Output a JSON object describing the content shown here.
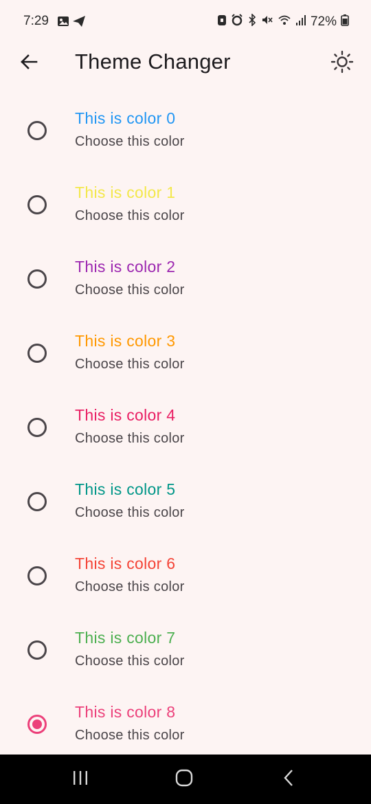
{
  "status": {
    "time": "7:29",
    "battery": "72%"
  },
  "appbar": {
    "title": "Theme Changer"
  },
  "colors": [
    {
      "title": "This is color 0",
      "subtitle": "Choose this color",
      "color": "#2196f3",
      "selected": false
    },
    {
      "title": "This is color 1",
      "subtitle": "Choose this color",
      "color": "#f3e84a",
      "selected": false
    },
    {
      "title": "This is color 2",
      "subtitle": "Choose this color",
      "color": "#9c27b0",
      "selected": false
    },
    {
      "title": "This is color 3",
      "subtitle": "Choose this color",
      "color": "#ff9800",
      "selected": false
    },
    {
      "title": "This is color 4",
      "subtitle": "Choose this color",
      "color": "#e91e63",
      "selected": false
    },
    {
      "title": "This is color 5",
      "subtitle": "Choose this color",
      "color": "#009688",
      "selected": false
    },
    {
      "title": "This is color 6",
      "subtitle": "Choose this color",
      "color": "#f44336",
      "selected": false
    },
    {
      "title": "This is color 7",
      "subtitle": "Choose this color",
      "color": "#4caf50",
      "selected": false
    },
    {
      "title": "This is color 8",
      "subtitle": "Choose this color",
      "color": "#ec407a",
      "selected": true
    }
  ]
}
